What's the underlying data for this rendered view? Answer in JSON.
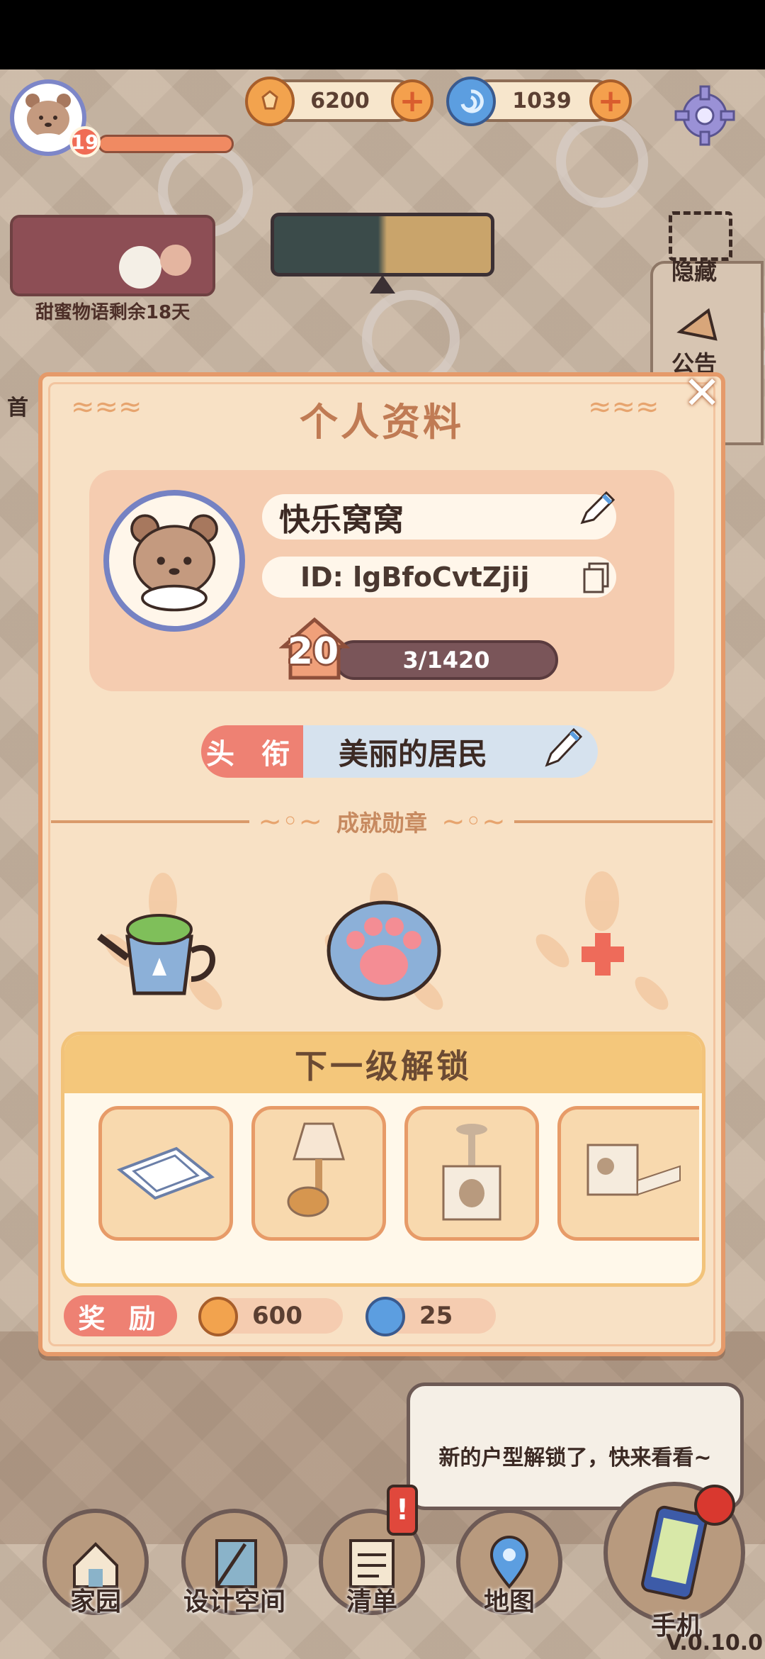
{
  "hud": {
    "player_level": "19",
    "coins": "6200",
    "gems": "1039",
    "event_text": "甜蜜物语剩余18天",
    "hide_label": "隐藏",
    "notice_label": "公告",
    "home_label_partial": "首"
  },
  "dialog": {
    "title": "个人资料",
    "nickname": "快乐窝窝",
    "id_text": "ID: lgBfoCvtZjij",
    "level": "20",
    "level_progress": "3/1420",
    "title_tag": "头 衔",
    "title_value": "美丽的居民",
    "achievements_title": "成就勋章",
    "next_unlock_title": "下一级解锁",
    "reward_tag": "奖 励",
    "reward_coins": "600",
    "reward_gems": "25",
    "unlock_items": [
      "blue-white-rug",
      "wall-lamp",
      "cat-tree",
      "cat-condo"
    ]
  },
  "speech_bubble": "新的户型解锁了，快来看看~",
  "bottom_nav": [
    "家园",
    "设计空间",
    "清单",
    "地图",
    "手机"
  ],
  "version": "V.0.10.0",
  "colors": {
    "dialog_bg": "#f8e1c5",
    "accent_orange": "#e59a6a",
    "title_tag": "#ee8173",
    "avatar_ring": "#7582c3"
  }
}
